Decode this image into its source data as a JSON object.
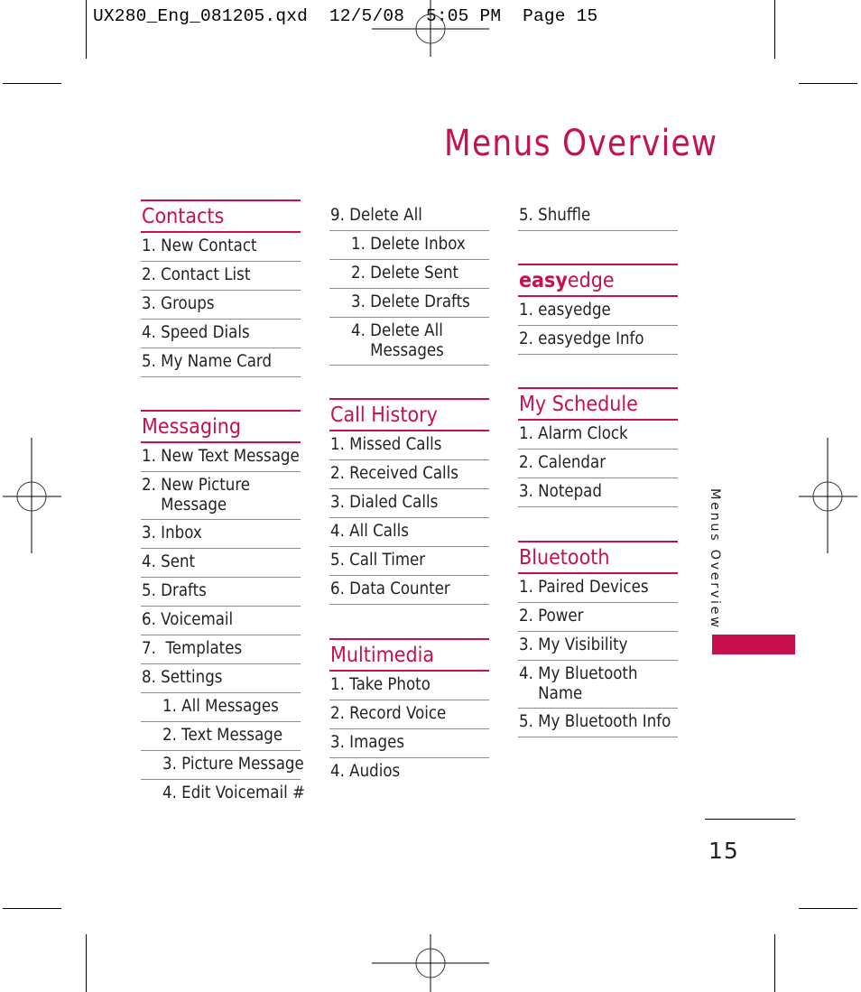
{
  "slug": {
    "filename": "UX280_Eng_081205.qxd",
    "date": "12/5/08",
    "time": "5:05 PM",
    "page_label": "Page 15",
    "full": "UX280_Eng_081205.qxd  12/5/08  5:05 PM  Page 15"
  },
  "title": "Menus Overview",
  "accent_color": "#c8104f",
  "side_tab": {
    "label": "Menus Overview"
  },
  "page_number": "15",
  "columns": [
    {
      "sections": [
        {
          "heading": "Contacts",
          "items": [
            "1. New Contact",
            "2. Contact List",
            "3. Groups",
            "4. Speed Dials",
            "5. My Name Card"
          ]
        },
        {
          "heading": "Messaging",
          "items": [
            "1. New Text Message",
            "2. New Picture\n    Message",
            "3. Inbox",
            "4. Sent",
            "5. Drafts",
            "6. Voicemail",
            "7.  Templates",
            "8. Settings"
          ],
          "subitems": [
            "1. All Messages",
            "2. Text Message",
            "3. Picture Message",
            "4. Edit Voicemail #"
          ]
        }
      ]
    },
    {
      "continued": {
        "item": "9. Delete All",
        "subitems": [
          "1. Delete Inbox",
          "2. Delete Sent",
          "3. Delete Drafts",
          "4. Delete All\n    Messages"
        ]
      },
      "sections": [
        {
          "heading": "Call History",
          "items": [
            "1. Missed Calls",
            "2. Received Calls",
            "3. Dialed Calls",
            "4. All Calls",
            "5. Call Timer",
            "6. Data Counter"
          ]
        },
        {
          "heading": "Multimedia",
          "items": [
            "1. Take Photo",
            "2. Record Voice",
            "3. Images",
            "4. Audios"
          ]
        }
      ]
    },
    {
      "continued": {
        "item": "5. Shuffle"
      },
      "sections": [
        {
          "heading_bold": "easy",
          "heading_rest": "edge",
          "items": [
            "1. easyedge",
            "2. easyedge Info"
          ]
        },
        {
          "heading": "My Schedule",
          "items": [
            "1. Alarm Clock",
            "2. Calendar",
            "3. Notepad"
          ]
        },
        {
          "heading": "Bluetooth",
          "items": [
            "1. Paired Devices",
            "2. Power",
            "3. My Visibility",
            "4. My Bluetooth\n    Name",
            "5. My Bluetooth Info"
          ]
        }
      ]
    }
  ]
}
